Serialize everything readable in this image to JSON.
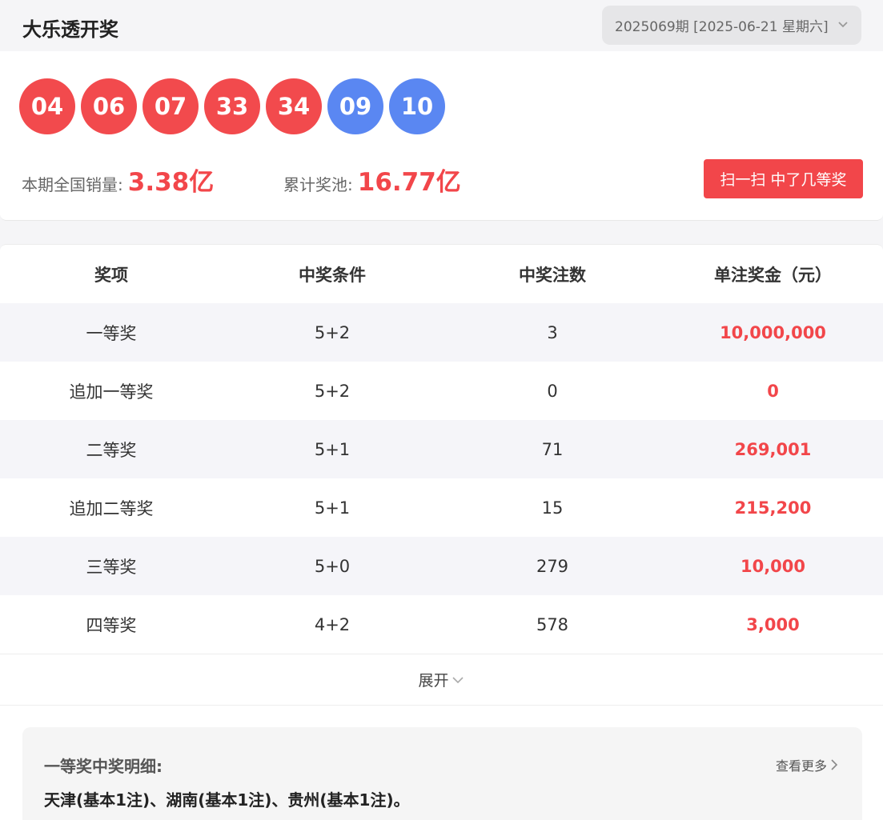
{
  "header": {
    "title": "大乐透开奖",
    "period": "2025069期 [2025-06-21 星期六]"
  },
  "draw": {
    "red_balls": [
      "04",
      "06",
      "07",
      "33",
      "34"
    ],
    "blue_balls": [
      "09",
      "10"
    ],
    "sales_label": "本期全国销量:",
    "sales_value": "3.38亿",
    "pool_label": "累计奖池:",
    "pool_value": "16.77亿",
    "scan_button": "扫一扫 中了几等奖"
  },
  "table": {
    "headers": [
      "奖项",
      "中奖条件",
      "中奖注数",
      "单注奖金（元）"
    ],
    "rows": [
      [
        "一等奖",
        "5+2",
        "3",
        "10,000,000"
      ],
      [
        "追加一等奖",
        "5+2",
        "0",
        "0"
      ],
      [
        "二等奖",
        "5+1",
        "71",
        "269,001"
      ],
      [
        "追加二等奖",
        "5+1",
        "15",
        "215,200"
      ],
      [
        "三等奖",
        "5+0",
        "279",
        "10,000"
      ],
      [
        "四等奖",
        "4+2",
        "578",
        "3,000"
      ]
    ],
    "expand_label": "展开"
  },
  "detail": {
    "title": "一等奖中奖明细:",
    "more_label": "查看更多",
    "text": "天津(基本1注)、湖南(基本1注)、贵州(基本1注)。"
  },
  "colors": {
    "red": "#f24a4d",
    "blue": "#5a87f2",
    "accent": "#f2464a"
  }
}
